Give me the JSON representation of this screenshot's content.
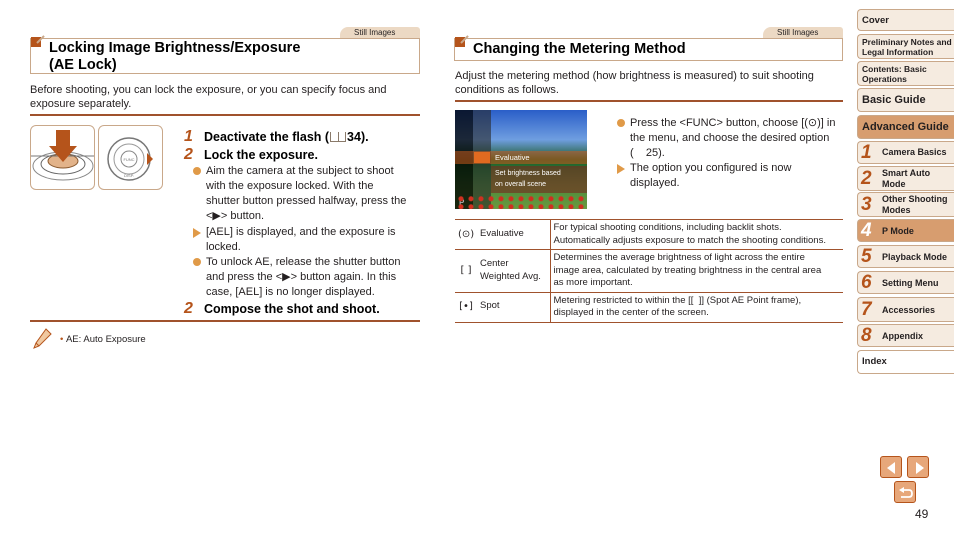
{
  "left": {
    "tag": "Still Images",
    "title_line1": "Locking Image Brightness/Exposure",
    "title_line2": "(AE Lock)",
    "intro_line1": "Before shooting, you can lock the exposure, or you can specify focus and",
    "intro_line2": "exposure separately.",
    "steps": [
      {
        "num": "1",
        "text": "Deactivate the flash (",
        "ref": "34)."
      },
      {
        "num": "2",
        "text": "Lock the exposure."
      },
      {
        "num": "2",
        "text": "Compose the shot and shoot."
      }
    ],
    "bullets": [
      {
        "type": "dot",
        "lines": [
          "Aim the camera at the subject to shoot",
          "with the exposure locked. With the",
          "shutter button pressed halfway, press the",
          "<▶> button."
        ]
      },
      {
        "type": "tri",
        "lines": [
          "[AEL] is displayed, and the exposure is",
          "locked."
        ]
      },
      {
        "type": "dot",
        "lines": [
          "To unlock AE, release the shutter button",
          "and press the <▶> button again. In this",
          "case, [AEL] is no longer displayed."
        ]
      }
    ],
    "note": "AE: Auto Exposure"
  },
  "right": {
    "tag": "Still Images",
    "title": "Changing the Metering Method",
    "intro_line1": "Adjust the metering method (how brightness is measured) to suit shooting",
    "intro_line2": "conditions as follows.",
    "screen": {
      "menu_label": "Evaluative",
      "hint_line1": "Set brightness based",
      "hint_line2": "on overall scene"
    },
    "bullets": [
      {
        "type": "dot",
        "lines": [
          "Press the <FUNC> button, choose [(⊙)] in",
          "the menu, and choose the desired option",
          "(    25)."
        ]
      },
      {
        "type": "tri",
        "lines": [
          "The option you configured is now",
          "displayed."
        ]
      }
    ],
    "table": [
      {
        "icon": "(⊙)",
        "name": [
          "Evaluative"
        ],
        "desc": [
          "For typical shooting conditions, including backlit shots.",
          "Automatically adjusts exposure to match the shooting conditions."
        ]
      },
      {
        "icon": "[ ]",
        "name": [
          "Center",
          "Weighted Avg."
        ],
        "desc": [
          "Determines the average brightness of light across the entire",
          "image area, calculated by treating brightness in the central area",
          "as more important."
        ]
      },
      {
        "icon": "[•]",
        "name": [
          "Spot"
        ],
        "desc": [
          "Metering restricted to within the [[  ]] (Spot AE Point frame),",
          "displayed in the center of the screen."
        ]
      }
    ]
  },
  "nav": {
    "items": [
      {
        "label": "Cover"
      },
      {
        "label": "Preliminary Notes and Legal Information"
      },
      {
        "label": "Contents: Basic Operations"
      },
      {
        "label": "Basic Guide"
      },
      {
        "label": "Advanced Guide",
        "active": true
      }
    ],
    "chapters": [
      {
        "num": "1",
        "label": "Camera Basics"
      },
      {
        "num": "2",
        "label": "Smart Auto Mode"
      },
      {
        "num": "3",
        "label": "Other Shooting Modes"
      },
      {
        "num": "4",
        "label": "P Mode",
        "active": true
      },
      {
        "num": "5",
        "label": "Playback Mode"
      },
      {
        "num": "6",
        "label": "Setting Menu"
      },
      {
        "num": "7",
        "label": "Accessories"
      },
      {
        "num": "8",
        "label": "Appendix"
      }
    ],
    "index": "Index"
  },
  "page_number": "49",
  "colors": {
    "accent": "#b5541b",
    "tab_bg": "#ecd9c4",
    "nav_bg": "#f5ebe0",
    "nav_active": "#d79d6f",
    "bullet": "#e09a48"
  }
}
